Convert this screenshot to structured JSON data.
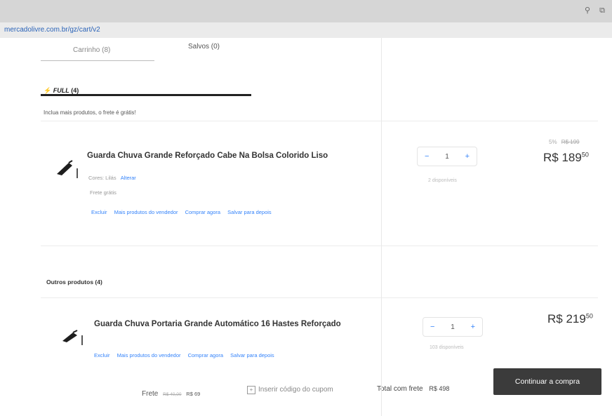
{
  "browser": {
    "url": "mercadolivre.com.br/gz/cart/v2",
    "icons": [
      "search-icon",
      "share-icon"
    ]
  },
  "tabs": {
    "cart": "Carrinho (8)",
    "saved": "Salvos (0)"
  },
  "full_section": {
    "brand": "FULL",
    "count": "(4)",
    "promo": "Inclua mais produtos, o frete é grátis!"
  },
  "product1": {
    "title": "Guarda Chuva Grande Reforçado Cabe Na Bolsa Colorido Liso",
    "meta": "Cores: Lilás",
    "change": "Alterar",
    "shipping": "Frete grátis",
    "actions": [
      "Excluir",
      "Mais produtos do vendedor",
      "Comprar agora",
      "Salvar para depois"
    ],
    "qty_minus": "−",
    "qty_value": "1",
    "qty_plus": "+",
    "available": "2 disponíveis",
    "discount": "5%",
    "old_price": "R$ 199",
    "price_main": "R$ 189",
    "price_cents": "50"
  },
  "other_section": {
    "title": "Outros produtos (4)"
  },
  "product2": {
    "title": "Guarda Chuva Portaria Grande Automático 16 Hastes Reforçado",
    "actions": [
      "Excluir",
      "Mais produtos do vendedor",
      "Comprar agora",
      "Salvar para depois"
    ],
    "qty_minus": "−",
    "qty_value": "1",
    "qty_plus": "+",
    "available": "103 disponíveis",
    "price_main": "R$ 219",
    "price_cents": "50"
  },
  "footer": {
    "frete_label": "Frete",
    "frete_old": "R$ 40,00",
    "frete_new": "R$ 69",
    "coupon": "Inserir código do cupom",
    "total_label": "Total com frete",
    "total_value": "R$ 498",
    "continue_button": "Continuar a compra"
  }
}
